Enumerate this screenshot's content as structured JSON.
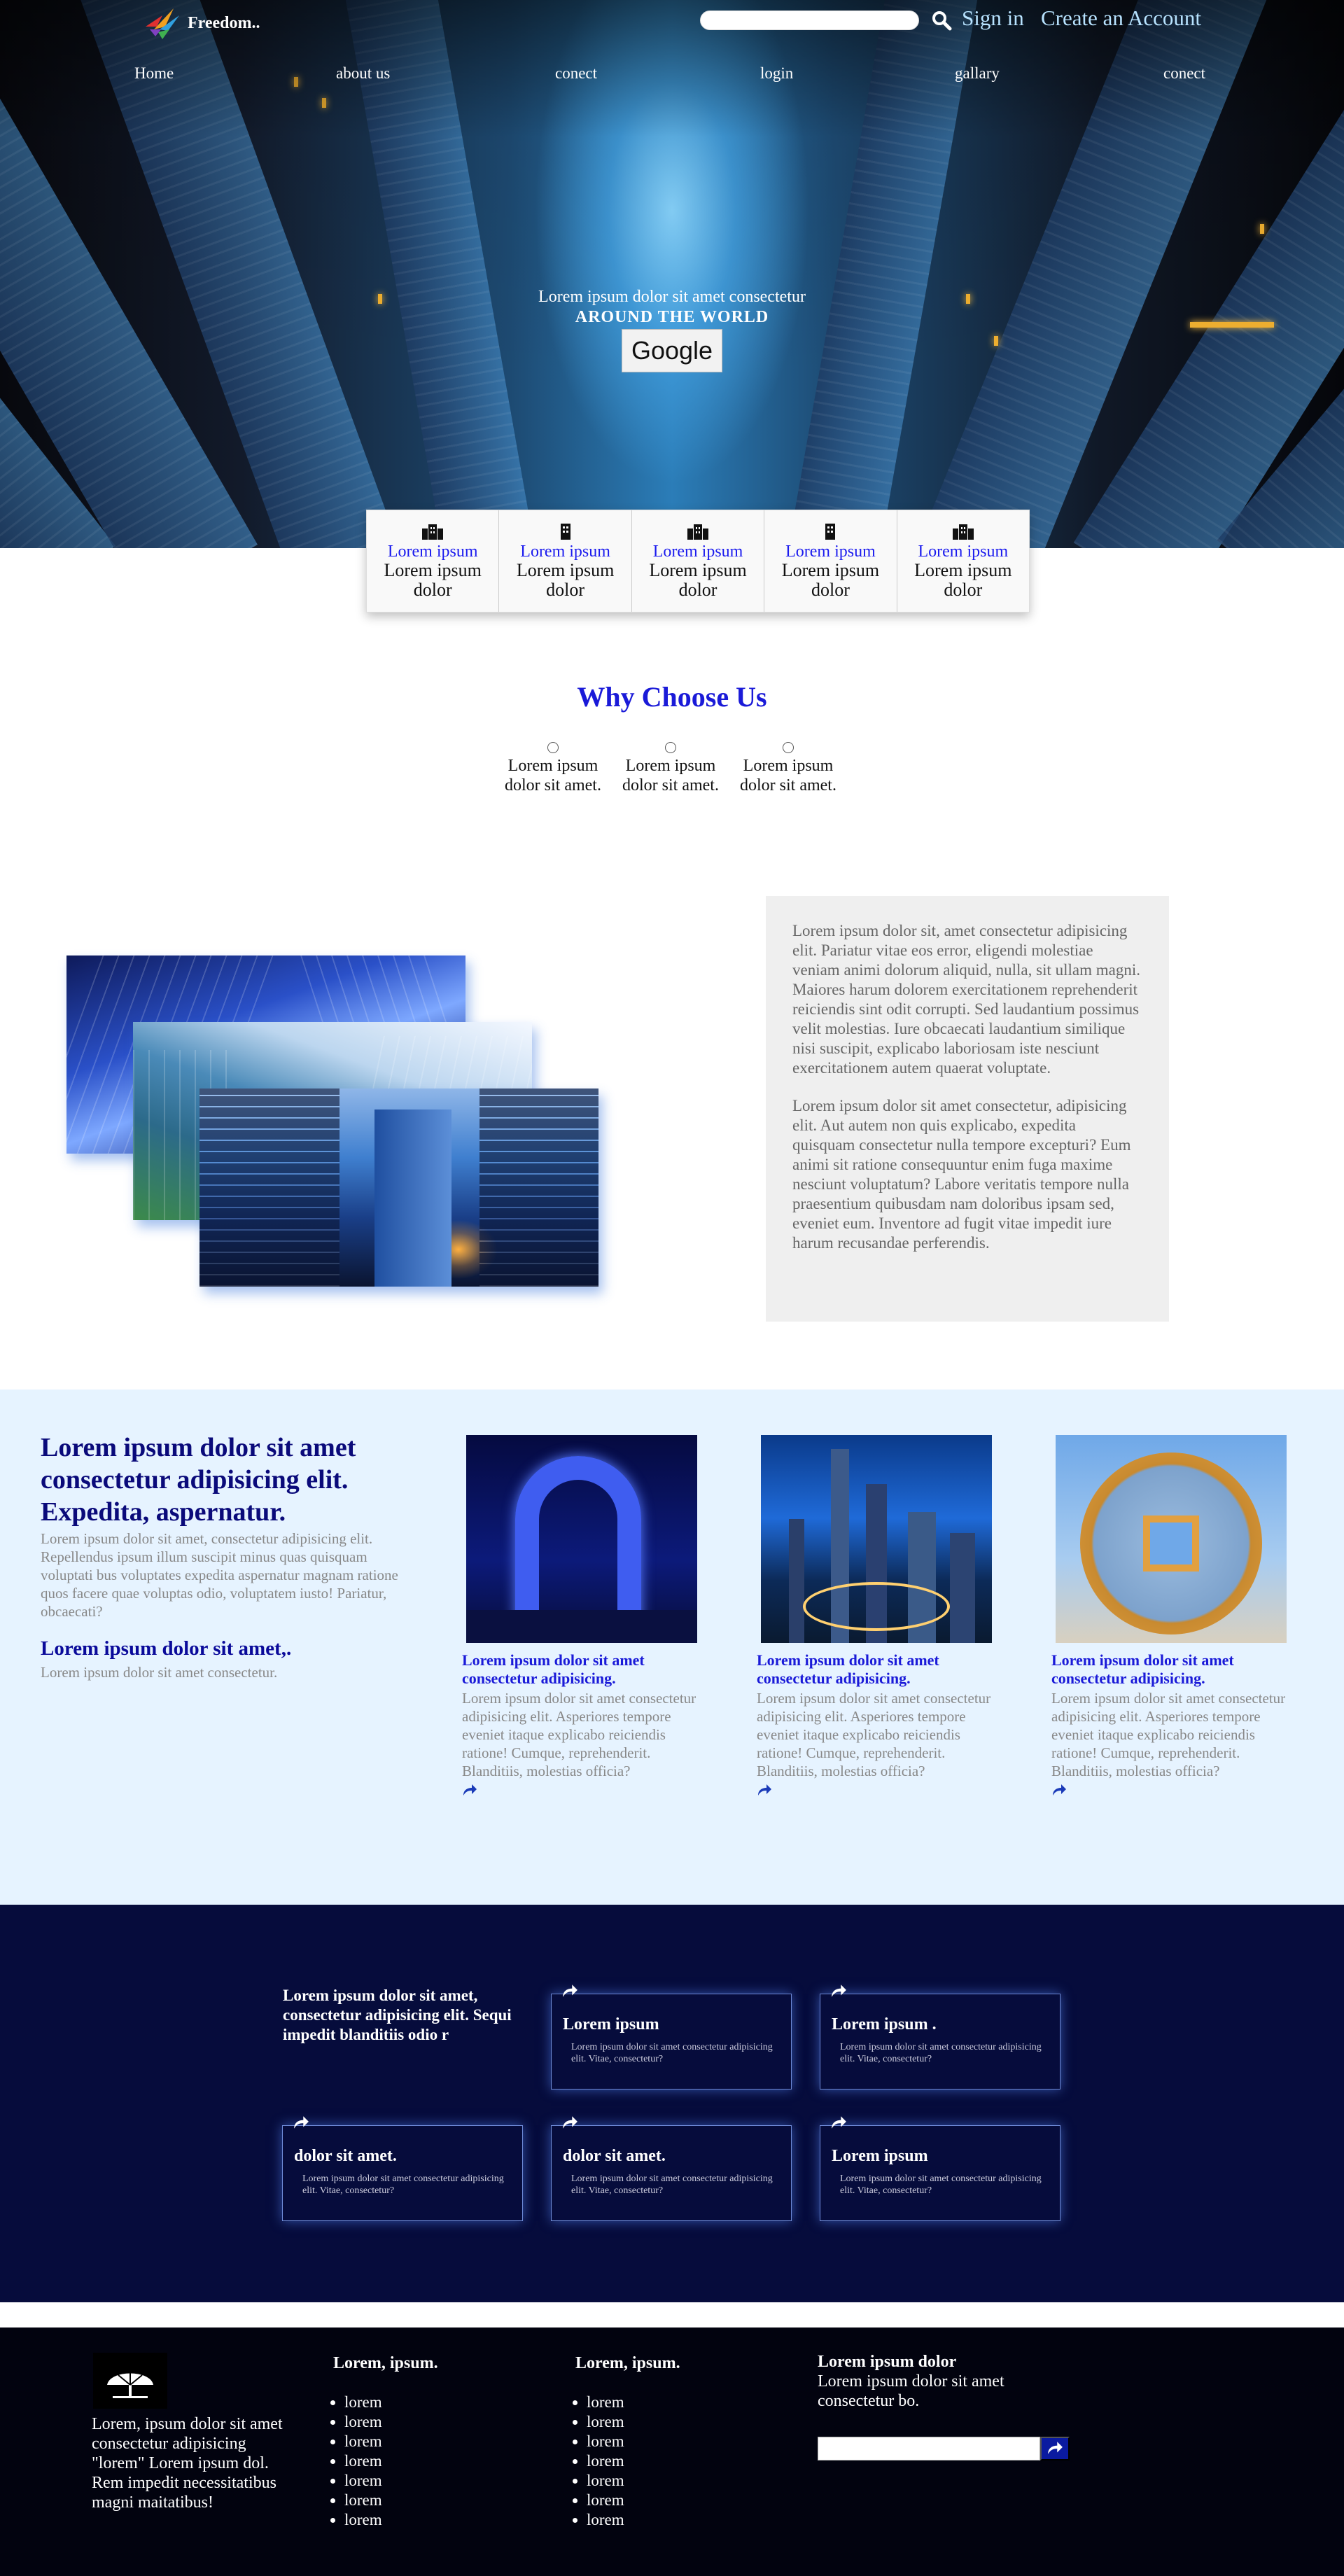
{
  "header": {
    "logo_text": "Freedom..",
    "search_placeholder": "",
    "signin_label": "Sign in",
    "create_account_label": "Create an Account"
  },
  "nav": [
    "Home",
    "about us",
    "conect",
    "login",
    "gallary",
    "conect"
  ],
  "hero": {
    "line1": "Lorem ipsum dolor sit amet consectetur",
    "line2": "AROUND THE WORLD",
    "button_label": "Google"
  },
  "features": [
    {
      "title": "Lorem ipsum",
      "subtitle": "Lorem ipsum dolor"
    },
    {
      "title": "Lorem ipsum",
      "subtitle": "Lorem ipsum dolor"
    },
    {
      "title": "Lorem ipsum",
      "subtitle": "Lorem ipsum dolor"
    },
    {
      "title": "Lorem ipsum",
      "subtitle": "Lorem ipsum dolor"
    },
    {
      "title": "Lorem ipsum",
      "subtitle": "Lorem ipsum dolor"
    }
  ],
  "why": {
    "title": "Why Choose Us",
    "items": [
      "Lorem ipsum dolor sit amet.",
      "Lorem ipsum dolor sit amet.",
      "Lorem ipsum dolor sit amet."
    ]
  },
  "about": {
    "para1": "Lorem ipsum dolor sit, amet consectetur adipisicing elit. Pariatur vitae eos error, eligendi molestiae veniam animi dolorum aliquid, nulla, sit ullam magni. Maiores harum dolorem exercitationem reprehenderit reiciendis sint odit corrupti. Sed laudantium possimus velit molestias. Iure obcaecati laudantium similique nisi suscipit, explicabo laboriosam iste nesciunt exercitationem autem quaerat voluptate.",
    "para2": "Lorem ipsum dolor sit amet consectetur, adipisicing elit. Aut autem non quis explicabo, expedita quisquam consectetur nulla tempore excepturi? Eum animi sit ratione consequuntur enim fuga maxime nesciunt voluptatum? Labore veritatis tempore nulla praesentium quibusdam nam doloribus ipsam sed, eveniet eum. Inventore ad fugit vitae impedit iure harum recusandae perferendis."
  },
  "highlights": {
    "heading": "Lorem ipsum dolor sit amet consectetur adipisicing elit. Expedita, aspernatur.",
    "paragraph": "Lorem ipsum dolor sit amet, consectetur adipisicing elit. Repellendus ipsum illum suscipit minus quas quisquam voluptati bus voluptates expedita aspernatur magnam ratione quos facere quae voluptas odio, voluptatem iusto! Pariatur, obcaecati?",
    "subheading": "Lorem ipsum dolor sit amet,.",
    "subtext": "Lorem ipsum dolor sit amet consectetur.",
    "cards": [
      {
        "title": "Lorem ipsum dolor sit amet consectetur adipisicing.",
        "text": "Lorem ipsum dolor sit amet consectetur adipisicing elit. Asperiores tempore eveniet itaque explicabo reiciendis ratione! Cumque, reprehenderit. Blanditiis, molestias officia?"
      },
      {
        "title": "Lorem ipsum dolor sit amet consectetur adipisicing.",
        "text": "Lorem ipsum dolor sit amet consectetur adipisicing elit. Asperiores tempore eveniet itaque explicabo reiciendis ratione! Cumque, reprehenderit. Blanditiis, molestias officia?"
      },
      {
        "title": "Lorem ipsum dolor sit amet consectetur adipisicing.",
        "text": "Lorem ipsum dolor sit amet consectetur adipisicing elit. Asperiores tempore eveniet itaque explicabo reiciendis ratione! Cumque, reprehenderit. Blanditiis, molestias officia?"
      }
    ]
  },
  "services": {
    "heading": "Lorem ipsum dolor sit amet, consectetur adipisicing elit. Sequi impedit blanditiis odio r",
    "cards": [
      {
        "title": "Lorem ipsum",
        "text": "Lorem ipsum dolor sit amet consectetur adipisicing elit. Vitae, consectetur?"
      },
      {
        "title": "Lorem ipsum .",
        "text": "Lorem ipsum dolor sit amet consectetur adipisicing elit. Vitae, consectetur?"
      },
      {
        "title": "dolor sit amet.",
        "text": "Lorem ipsum dolor sit amet consectetur adipisicing elit. Vitae, consectetur?"
      },
      {
        "title": "dolor sit amet.",
        "text": "Lorem ipsum dolor sit amet consectetur adipisicing elit. Vitae, consectetur?"
      },
      {
        "title": "Lorem ipsum",
        "text": "Lorem ipsum dolor sit amet consectetur adipisicing elit. Vitae, consectetur?"
      }
    ]
  },
  "footer": {
    "about": "Lorem, ipsum dolor sit amet consectetur adipisicing \"lorem\" Lorem ipsum dol. Rem impedit necessitatibus magni maitatibus!",
    "col1_title": "Lorem, ipsum.",
    "col1_items": [
      "lorem",
      "lorem",
      "lorem",
      "lorem",
      "lorem",
      "lorem",
      "lorem"
    ],
    "col2_title": "Lorem, ipsum.",
    "col2_items": [
      "lorem",
      "lorem",
      "lorem",
      "lorem",
      "lorem",
      "lorem",
      "lorem"
    ],
    "news_title": "Lorem ipsum dolor",
    "news_text": "Lorem ipsum dolor sit amet consectetur bo.",
    "news_placeholder": ""
  },
  "colors": {
    "accent_blue": "#1a1ad8",
    "dark_navy": "#060c3c",
    "light_blue_bg": "#e6f3ff",
    "footer_bg": "#02030f"
  },
  "icons": [
    "search-icon",
    "building-icon",
    "share-icon",
    "tree-logo-icon",
    "bird-logo-icon"
  ]
}
